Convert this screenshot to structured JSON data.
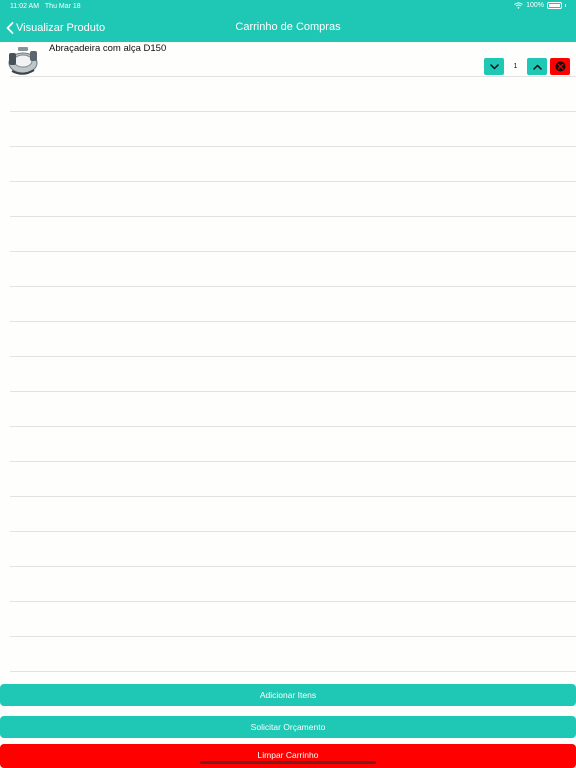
{
  "status_bar": {
    "time": "11:02 AM",
    "date": "Thu Mar 18",
    "battery": "100%"
  },
  "nav": {
    "back_label": "Visualizar Produto",
    "title": "Carrinho de Compras"
  },
  "cart": {
    "items": [
      {
        "name": "Abraçadeira com alça D150",
        "quantity": "1"
      }
    ]
  },
  "actions": {
    "add_items": "Adicionar Itens",
    "request_quote": "Solicitar Orçamento",
    "clear_cart": "Limpar Carrinho"
  },
  "colors": {
    "accent": "#1ec8b4",
    "danger": "#ff0000"
  }
}
